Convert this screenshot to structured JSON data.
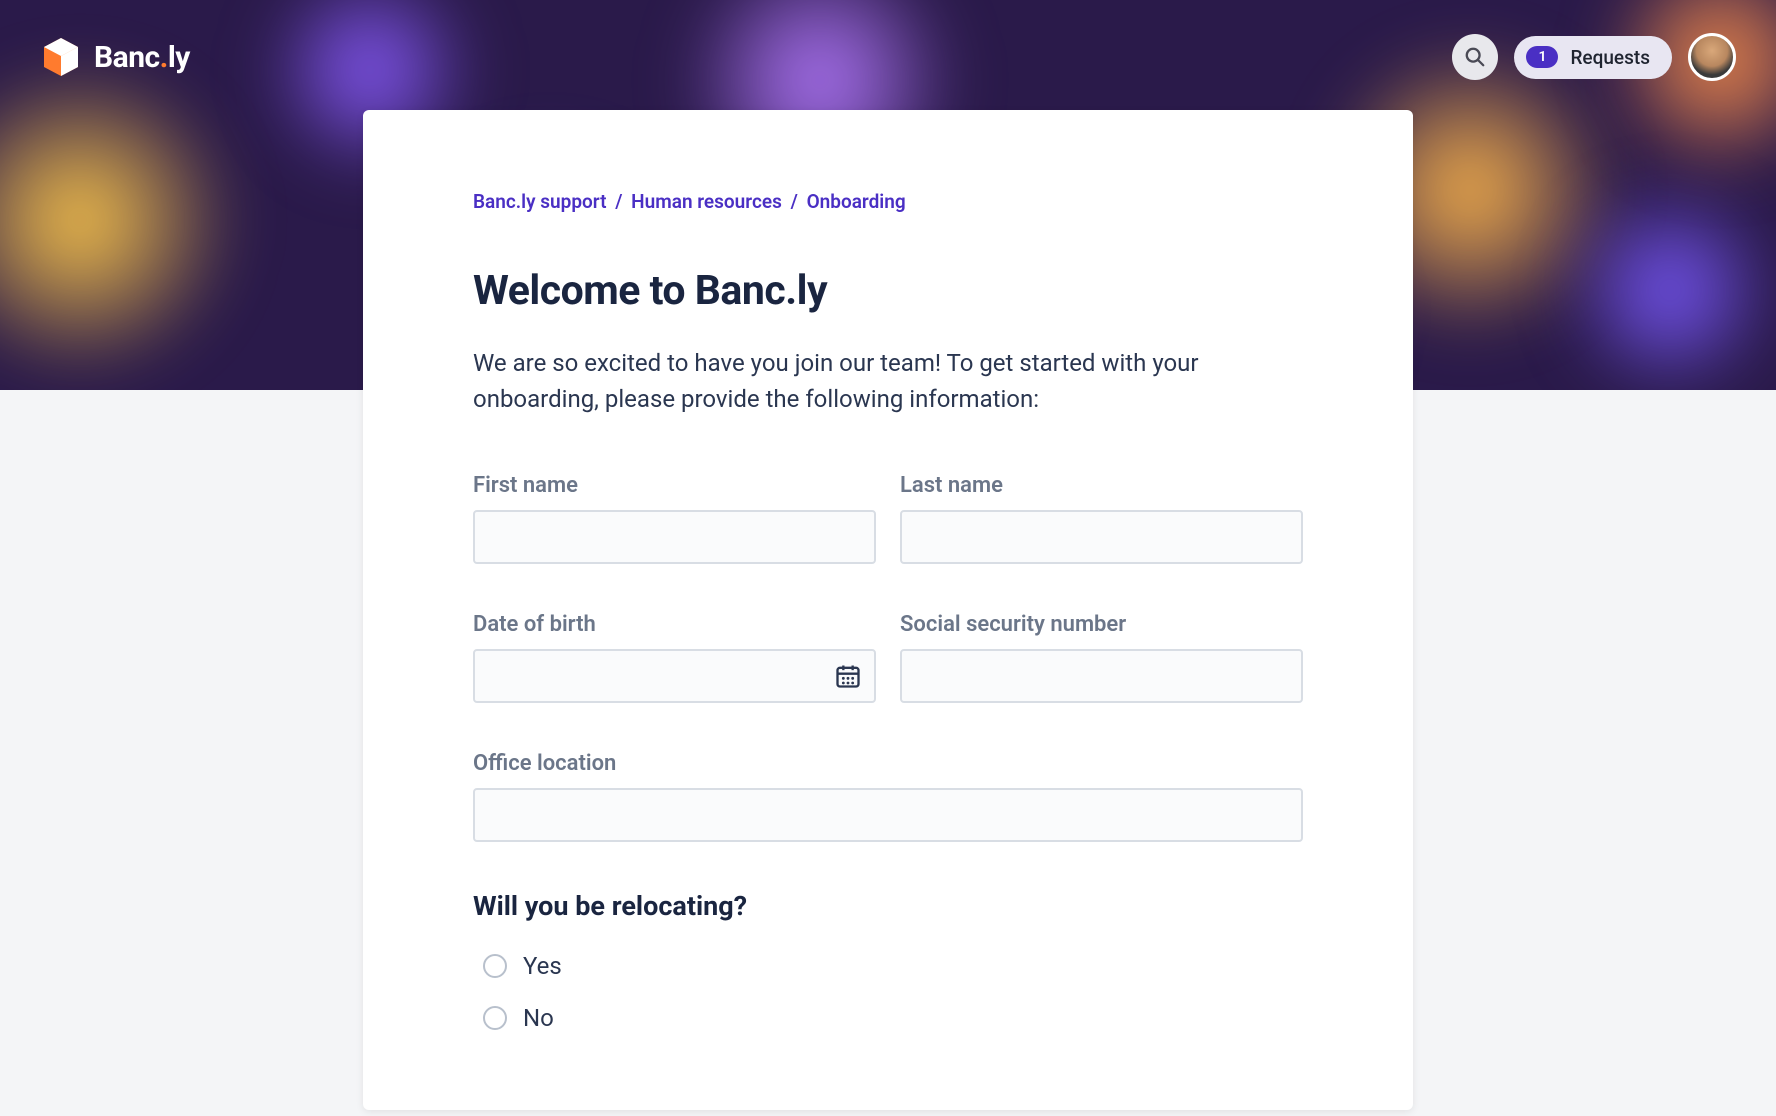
{
  "brand": {
    "name_part1": "Banc",
    "name_dot": ".",
    "name_part2": "ly"
  },
  "header": {
    "requests_count": "1",
    "requests_label": "Requests"
  },
  "breadcrumb": {
    "item1": "Banc.ly support",
    "item2": "Human resources",
    "item3": "Onboarding",
    "sep": "/"
  },
  "page": {
    "title": "Welcome to Banc.ly",
    "intro": "We are so excited to have you join our team! To get started with your onboarding, please provide the following information:"
  },
  "fields": {
    "first_name_label": "First name",
    "last_name_label": "Last name",
    "dob_label": "Date of birth",
    "ssn_label": "Social security number",
    "office_location_label": "Office location"
  },
  "question": {
    "relocating_label": "Will you be relocating?",
    "option_yes": "Yes",
    "option_no": "No"
  },
  "colors": {
    "accent": "#4a2fc4",
    "brand_orange": "#ff7b2e",
    "heading": "#1a2540"
  }
}
